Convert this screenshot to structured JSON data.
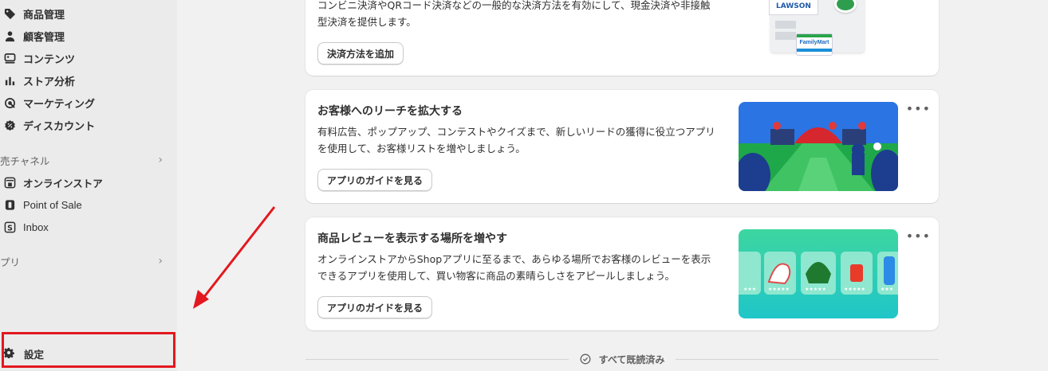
{
  "sidebar": {
    "items": [
      {
        "label": "商品管理",
        "icon": "tag-icon"
      },
      {
        "label": "顧客管理",
        "icon": "person-icon"
      },
      {
        "label": "コンテンツ",
        "icon": "content-icon"
      },
      {
        "label": "ストア分析",
        "icon": "bar-chart-icon"
      },
      {
        "label": "マーケティング",
        "icon": "target-icon"
      },
      {
        "label": "ディスカウント",
        "icon": "discount-icon"
      }
    ],
    "sales_channels_label": "売チャネル",
    "channels": [
      {
        "label": "オンラインストア",
        "icon": "store-icon"
      },
      {
        "label": "Point of Sale",
        "icon": "pos-icon"
      },
      {
        "label": "Inbox",
        "icon": "inbox-icon"
      }
    ],
    "apps_label": "プリ",
    "settings_label": "設定",
    "highlight_color": "#e3181f"
  },
  "cards": [
    {
      "desc": "コンビニ決済やQRコード決済などの一般的な決済方法を有効にして、現金決済や非接触型決済を提供します。",
      "button": "決済方法を追加",
      "image_labels": [
        "LAWSON",
        "FamilyMart"
      ]
    },
    {
      "title": "お客様へのリーチを拡大する",
      "desc": "有料広告、ポップアップ、コンテストやクイズまで、新しいリードの獲得に役立つアプリを使用して、お客様リストを増やしましょう。",
      "button": "アプリのガイドを見る",
      "menu": "•••"
    },
    {
      "title": "商品レビューを表示する場所を増やす",
      "desc": "オンラインストアからShopアプリに至るまで、あらゆる場所でお客様のレビューを表示できるアプリを使用して、買い物客に商品の素晴らしさをアピールしましょう。",
      "button": "アプリのガイドを見る",
      "menu": "•••"
    }
  ],
  "footer": {
    "label": "すべて既読済み"
  }
}
